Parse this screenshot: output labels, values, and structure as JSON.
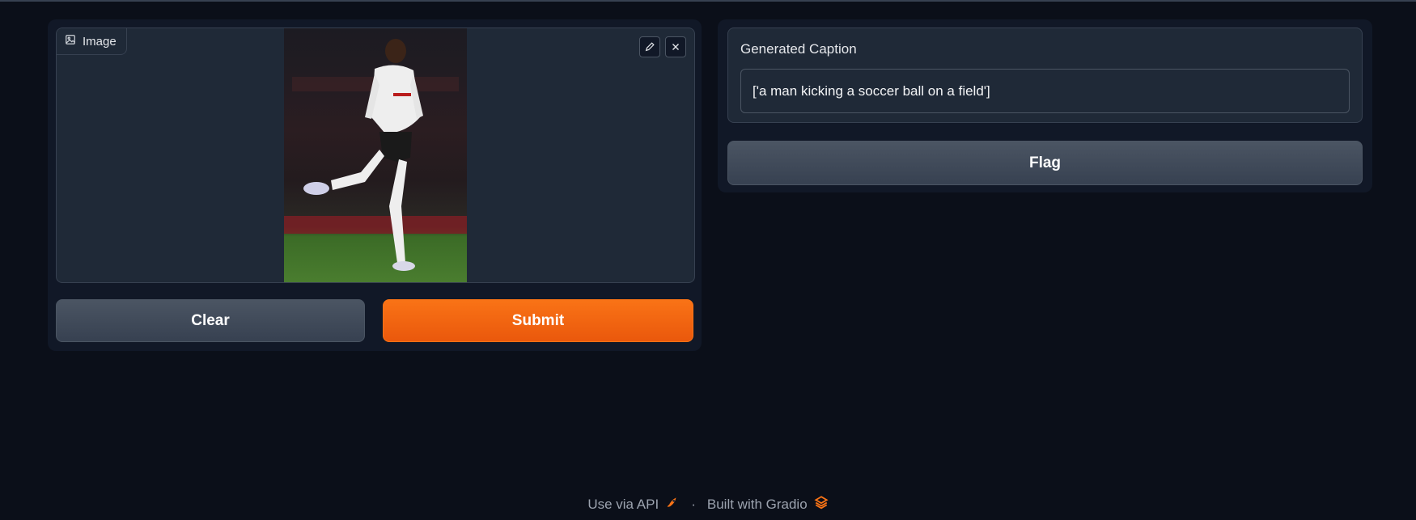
{
  "image_input": {
    "label": "Image"
  },
  "buttons": {
    "clear": "Clear",
    "submit": "Submit",
    "flag": "Flag"
  },
  "output": {
    "label": "Generated Caption",
    "value": "['a man kicking a soccer ball on a field']"
  },
  "footer": {
    "api_link": "Use via API",
    "separator": "·",
    "built_with": "Built with Gradio"
  },
  "colors": {
    "accent": "#f97316",
    "background": "#0b0f19",
    "panel": "#111827",
    "block": "#1f2937"
  },
  "icons": {
    "image": "image-icon",
    "edit": "pencil-icon",
    "close": "close-icon",
    "api": "rocket-icon",
    "gradio": "gradio-logo-icon"
  }
}
